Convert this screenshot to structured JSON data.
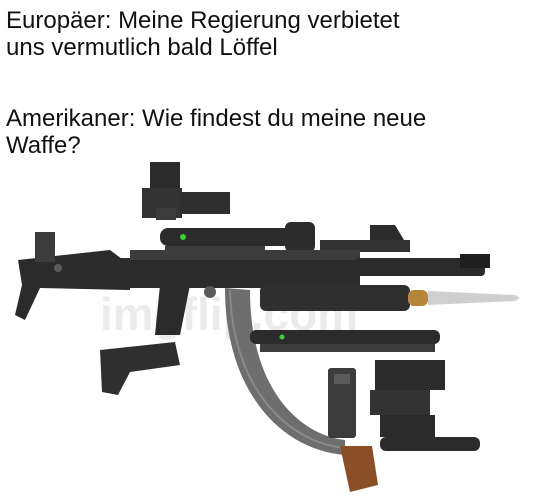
{
  "meme": {
    "caption_1": "Europäer: Meine Regierung verbietet\nuns vermutlich bald Löffel",
    "caption_2": "Amerikaner: Wie findest du meine neue\nWaffe?"
  },
  "image": {
    "subject": "overloaded-assault-rifle-with-accessories",
    "watermark_text": "imgflip.com",
    "colors": {
      "gun_dark": "#2b2b2b",
      "gun_mid": "#3c3c3c",
      "gun_light": "#5a5a5a",
      "magazine": "#6e6e6e",
      "bayonet": "#cfcfcf",
      "brass": "#b8863b",
      "wood_grip": "#8a4f26",
      "green_dot": "#3ad13a"
    }
  }
}
